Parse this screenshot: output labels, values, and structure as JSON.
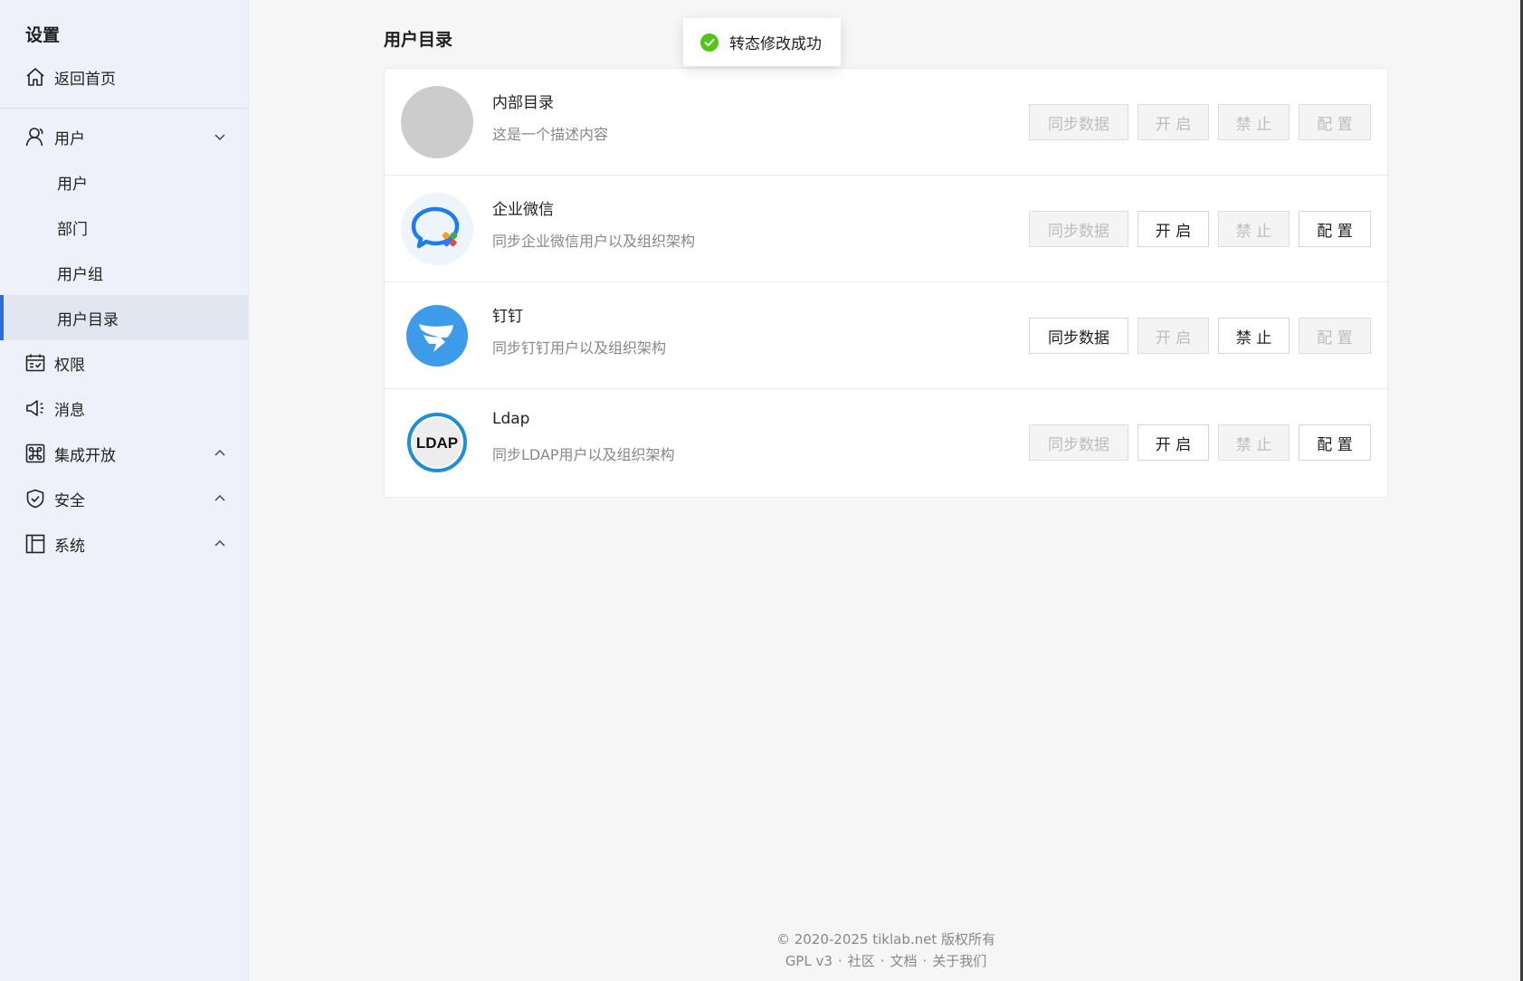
{
  "sidebar": {
    "title": "设置",
    "home": {
      "label": "返回首页",
      "icon": "home-icon"
    },
    "user_group": {
      "label": "用户",
      "icon": "user-icon",
      "expanded": true,
      "children": [
        {
          "label": "用户"
        },
        {
          "label": "部门"
        },
        {
          "label": "用户组"
        },
        {
          "label": "用户目录",
          "active": true
        }
      ]
    },
    "permission": {
      "label": "权限",
      "icon": "calendar-permission-icon"
    },
    "message": {
      "label": "消息",
      "icon": "megaphone-icon"
    },
    "integration": {
      "label": "集成开放",
      "icon": "command-icon",
      "expanded": false
    },
    "security": {
      "label": "安全",
      "icon": "shield-icon",
      "expanded": false
    },
    "system": {
      "label": "系统",
      "icon": "layout-icon",
      "expanded": false
    }
  },
  "main": {
    "title": "用户目录",
    "directories": [
      {
        "name": "内部目录",
        "desc": "这是一个描述内容",
        "logo": "gray-circle",
        "buttons": {
          "sync": "同步数据",
          "on": "开 启",
          "off": "禁 止",
          "config": "配 置"
        },
        "enabled": {
          "sync": false,
          "on": false,
          "off": false,
          "config": false
        }
      },
      {
        "name": "企业微信",
        "desc": "同步企业微信用户以及组织架构",
        "logo": "wecom-logo",
        "buttons": {
          "sync": "同步数据",
          "on": "开 启",
          "off": "禁 止",
          "config": "配 置"
        },
        "enabled": {
          "sync": false,
          "on": true,
          "off": false,
          "config": true
        }
      },
      {
        "name": "钉钉",
        "desc": "同步钉钉用户以及组织架构",
        "logo": "dingtalk-logo",
        "buttons": {
          "sync": "同步数据",
          "on": "开 启",
          "off": "禁 止",
          "config": "配 置"
        },
        "enabled": {
          "sync": true,
          "on": false,
          "off": true,
          "config": false
        }
      },
      {
        "name": "Ldap",
        "desc": "同步LDAP用户以及组织架构",
        "logo": "ldap-logo",
        "logo_text": "LDAP",
        "buttons": {
          "sync": "同步数据",
          "on": "开 启",
          "off": "禁 止",
          "config": "配 置"
        },
        "enabled": {
          "sync": false,
          "on": true,
          "off": false,
          "config": true
        }
      }
    ]
  },
  "toast": {
    "text": "转态修改成功",
    "icon": "check-circle-icon",
    "color": "#52c41a"
  },
  "footer": {
    "copyright": "© 2020-2025 tiklab.net 版权所有",
    "links": [
      "GPL v3",
      "社区",
      "文档",
      "关于我们"
    ]
  },
  "colors": {
    "accent": "#2d6cdf",
    "sidebar_bg": "#eef1f9",
    "dingtalk": "#3d9be9",
    "ldap": "#1e8fd6"
  }
}
